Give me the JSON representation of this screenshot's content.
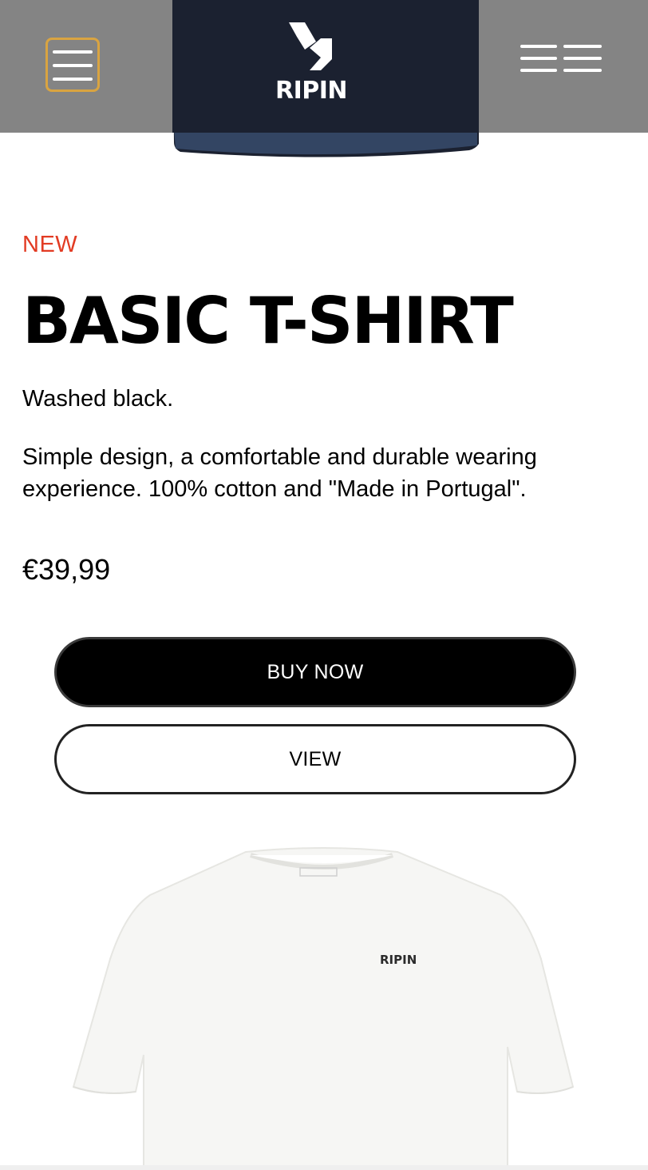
{
  "header": {
    "logo_text": "RIPIN",
    "left_menu_icon": "hamburger-icon",
    "right_menu_icon": "double-hamburger-icon",
    "focus_color": "#d9a441",
    "header_color": "#808080"
  },
  "product": {
    "badge": "NEW",
    "badge_color": "#e23b23",
    "title": "BASIC T-SHIRT",
    "subtitle": "Washed black.",
    "description": "Simple design, a comfortable and durable wearing experience. 100% cotton and \"Made in Portugal\".",
    "price": "€39,99"
  },
  "actions": {
    "buy_label": "BUY NOW",
    "view_label": "VIEW"
  },
  "next_product": {
    "logo_text": "RIPIN"
  }
}
